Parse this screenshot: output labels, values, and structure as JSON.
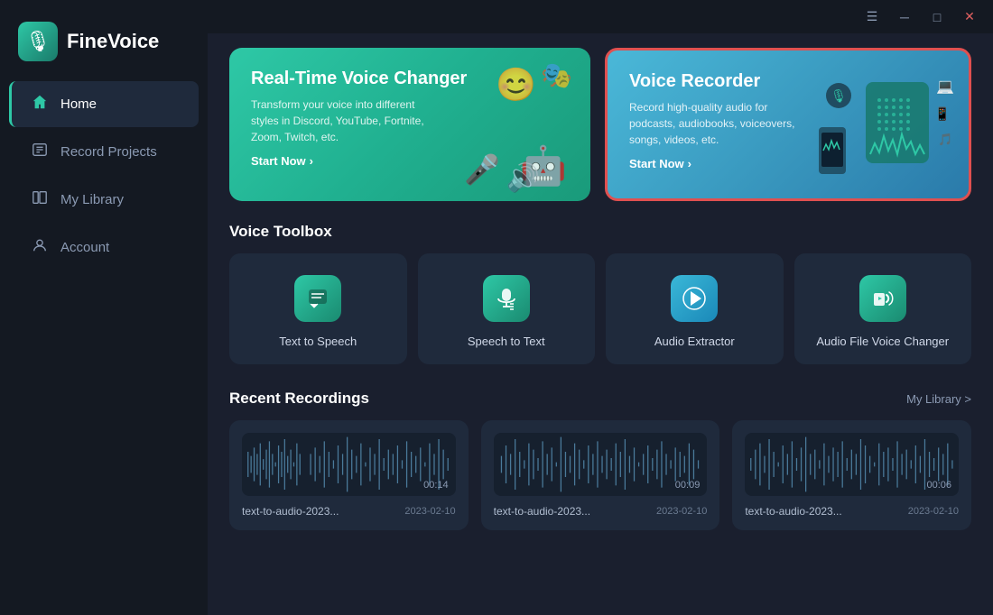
{
  "app": {
    "name": "FineVoice",
    "logo_emoji": "🎙"
  },
  "titlebar": {
    "menu_icon": "☰",
    "minimize_icon": "─",
    "maximize_icon": "□",
    "close_icon": "✕"
  },
  "sidebar": {
    "items": [
      {
        "id": "home",
        "label": "Home",
        "icon": "⌂",
        "active": true
      },
      {
        "id": "record-projects",
        "label": "Record Projects",
        "icon": "⊞"
      },
      {
        "id": "my-library",
        "label": "My Library",
        "icon": "▦"
      },
      {
        "id": "account",
        "label": "Account",
        "icon": "○"
      }
    ]
  },
  "banners": {
    "left": {
      "title": "Real-Time Voice Changer",
      "description": "Transform your voice into different styles in Discord, YouTube, Fortnite, Zoom, Twitch, etc.",
      "link_text": "Start Now",
      "link_arrow": "›"
    },
    "right": {
      "title": "Voice Recorder",
      "description": "Record high-quality audio for podcasts, audiobooks, voiceovers, songs, videos, etc.",
      "link_text": "Start Now",
      "link_arrow": "›"
    }
  },
  "toolbox": {
    "title": "Voice Toolbox",
    "tools": [
      {
        "id": "text-to-speech",
        "label": "Text to Speech",
        "icon": "📝"
      },
      {
        "id": "speech-to-text",
        "label": "Speech to Text",
        "icon": "🎤"
      },
      {
        "id": "audio-extractor",
        "label": "Audio Extractor",
        "icon": "▶"
      },
      {
        "id": "audio-file-voice-changer",
        "label": "Audio File Voice Changer",
        "icon": "🎵"
      }
    ]
  },
  "recent_recordings": {
    "title": "Recent Recordings",
    "library_link": "My Library >",
    "recordings": [
      {
        "id": "rec1",
        "name": "text-to-audio-2023...",
        "date": "2023-02-10",
        "duration": "00:14"
      },
      {
        "id": "rec2",
        "name": "text-to-audio-2023...",
        "date": "2023-02-10",
        "duration": "00:09"
      },
      {
        "id": "rec3",
        "name": "text-to-audio-2023...",
        "date": "2023-02-10",
        "duration": "00:06"
      }
    ]
  }
}
